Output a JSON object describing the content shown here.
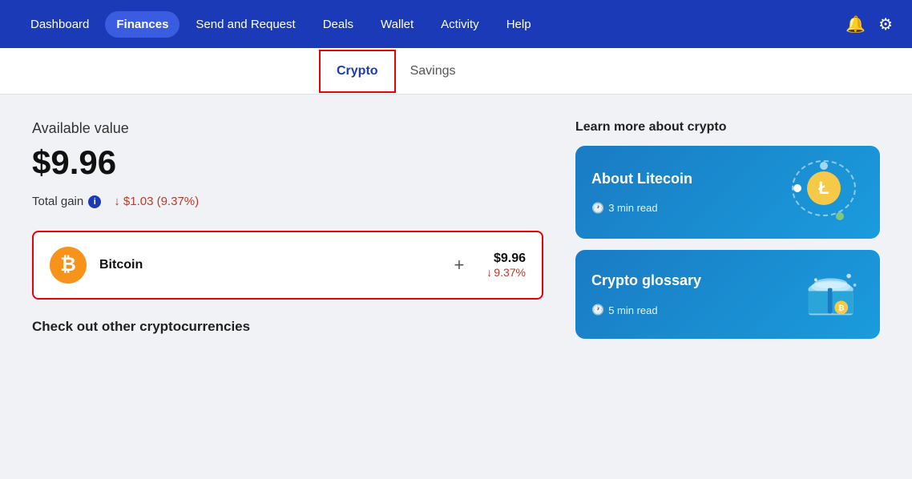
{
  "nav": {
    "items": [
      {
        "label": "Dashboard",
        "active": false
      },
      {
        "label": "Finances",
        "active": true
      },
      {
        "label": "Send and Request",
        "active": false
      },
      {
        "label": "Deals",
        "active": false
      },
      {
        "label": "Wallet",
        "active": false
      },
      {
        "label": "Activity",
        "active": false
      },
      {
        "label": "Help",
        "active": false
      }
    ],
    "bell_icon": "🔔",
    "gear_icon": "⚙"
  },
  "sub_tabs": [
    {
      "label": "Crypto",
      "active": true
    },
    {
      "label": "Savings",
      "active": false
    }
  ],
  "main": {
    "available_label": "Available value",
    "available_value": "$9.96",
    "total_gain_label": "Total gain",
    "total_gain_value": "↓ $1.03 (9.37%)",
    "bitcoin_name": "Bitcoin",
    "bitcoin_usd": "$9.96",
    "bitcoin_change": "↓ 9.37%",
    "check_other": "Check out other cryptocurrencies"
  },
  "right": {
    "learn_title": "Learn more about crypto",
    "cards": [
      {
        "title": "About Litecoin",
        "read_time": "3 min read"
      },
      {
        "title": "Crypto glossary",
        "read_time": "5 min read"
      }
    ]
  }
}
